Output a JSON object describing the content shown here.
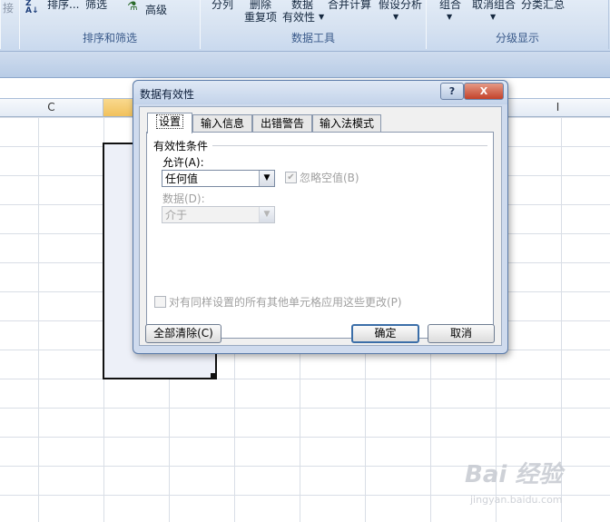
{
  "ribbon": {
    "top_row": [
      "接",
      "排序...",
      "筛选",
      "高级",
      "分列",
      "删除",
      "数据",
      "合并计算",
      "假设分析",
      "组合",
      "取消组合",
      "分类汇总"
    ],
    "second_row": [
      "重复项",
      "有效性"
    ],
    "groups": [
      "排序和筛选",
      "数据工具",
      "分级显示"
    ],
    "sort_icon_text": "Z\nA"
  },
  "columns": [
    "C",
    "I"
  ],
  "dialog": {
    "title": "数据有效性",
    "help_label": "?",
    "close_label": "X",
    "tabs": [
      "设置",
      "输入信息",
      "出错警告",
      "输入法模式"
    ],
    "section_title": "有效性条件",
    "allow_label": "允许(A):",
    "allow_value": "任何值",
    "ignore_blank_label": "忽略空值(B)",
    "data_label": "数据(D):",
    "data_value": "介于",
    "apply_all_label": "对有同样设置的所有其他单元格应用这些更改(P)",
    "clear_all_label": "全部清除(C)",
    "ok_label": "确定",
    "cancel_label": "取消"
  },
  "watermark": {
    "main": "Bai 经验",
    "sub": "jingyan.baidu.com"
  }
}
